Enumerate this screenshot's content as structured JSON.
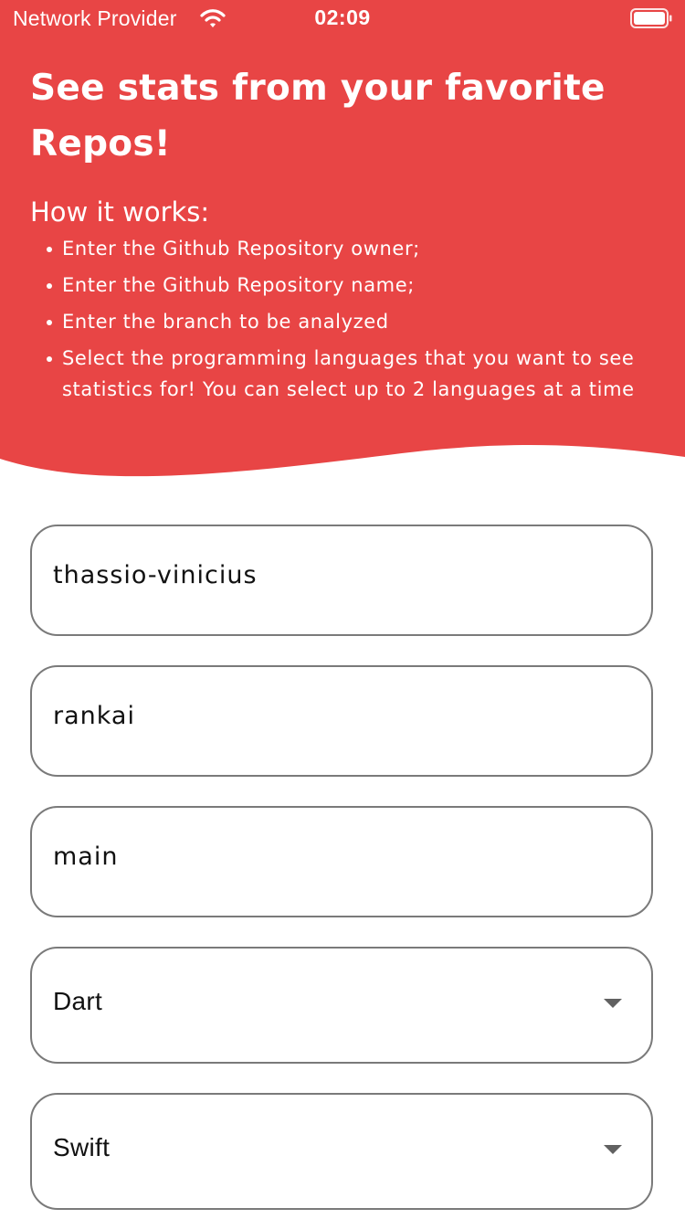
{
  "status_bar": {
    "carrier": "Network Provider",
    "time": "02:09",
    "wifi_icon": "wifi-icon",
    "battery_icon": "battery-icon"
  },
  "header": {
    "background_color": "#E84545",
    "title": "See stats from your favorite Repos!",
    "subtitle": "How it works:",
    "steps": [
      "Enter the Github Repository owner;",
      "Enter the Github Repository name;",
      "Enter the branch to be analyzed",
      "Select the programming languages that you want to see statistics for! You can select up to 2 languages at a time"
    ]
  },
  "form": {
    "owner_value": "thassio-vinicius",
    "repo_value": "rankai",
    "branch_value": "main",
    "language_1": "Dart",
    "language_2": "Swift",
    "dropdown_icon": "caret-down-icon"
  }
}
